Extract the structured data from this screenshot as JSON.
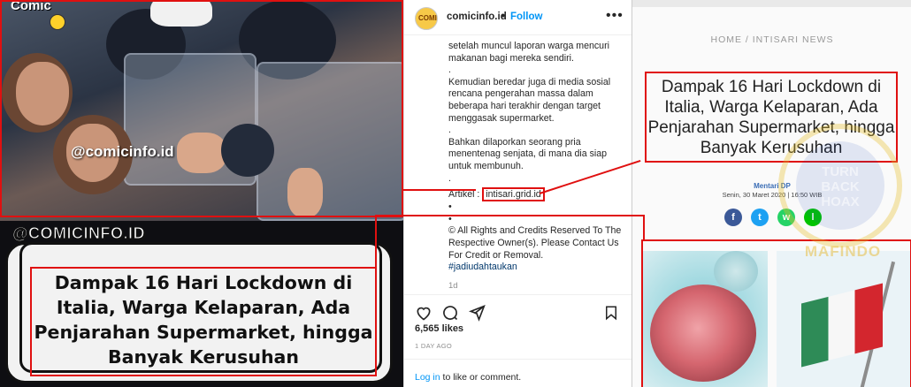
{
  "left_panel": {
    "watermark_logo": "Comic",
    "photo_handle": "@comicinfo.id",
    "banner_handle": "@COMICINFO.ID",
    "banner_title": "Dampak 16 Hari Lockdown di Italia, Warga Kelaparan, Ada Penjarahan Supermarket, hingga Banyak Kerusuhan"
  },
  "instagram": {
    "username": "comicinfo.id",
    "avatar_text": "COMIC",
    "follow_label": "Follow",
    "more_label": "•••",
    "caption": [
      "setelah muncul laporan warga mencuri makanan bagi mereka sendiri.",
      ".",
      "Kemudian beredar juga di media sosial rencana pengerahan massa dalam beberapa hari terakhir dengan target menggasak supermarket.",
      ".",
      "Bahkan dilaporkan seorang pria menentenag senjata, di mana dia siap untuk membunuh.",
      "."
    ],
    "article_prefix": "Artikel :",
    "article_link": "intisari.grid.id",
    "dot_1": "•",
    "dot_2": "•",
    "credits": "© All Rights and Credits Reserved To The Respective Owner(s). Please Contact Us For Credit or Removal.",
    "hashtag": "#jadiudahtaukan",
    "time_short": "1d",
    "likes": "6,565 likes",
    "time_ago": "1 DAY AGO",
    "login_link": "Log in",
    "login_suffix": " to like or comment."
  },
  "article": {
    "breadcrumb_home": "HOME",
    "breadcrumb_sep": " / ",
    "breadcrumb_section": "INTISARI NEWS",
    "title": "Dampak 16 Hari Lockdown di Italia, Warga Kelaparan, Ada Penjarahan Supermarket, hingga Banyak Kerusuhan",
    "author": "Mentari DP",
    "date": "Senin, 30 Maret 2020 | 16:50 WIB",
    "share": [
      {
        "label": "f",
        "color": "#3b5998"
      },
      {
        "label": "t",
        "color": "#1da1f2"
      },
      {
        "label": "w",
        "color": "#25d366"
      },
      {
        "label": "l",
        "color": "#00c300"
      }
    ]
  },
  "stamp": {
    "top_text": "TURN BACK HOAX",
    "bottom_text": "MAFINDO"
  },
  "colors": {
    "highlight": "#e01010",
    "ig_blue": "#0095f6"
  }
}
